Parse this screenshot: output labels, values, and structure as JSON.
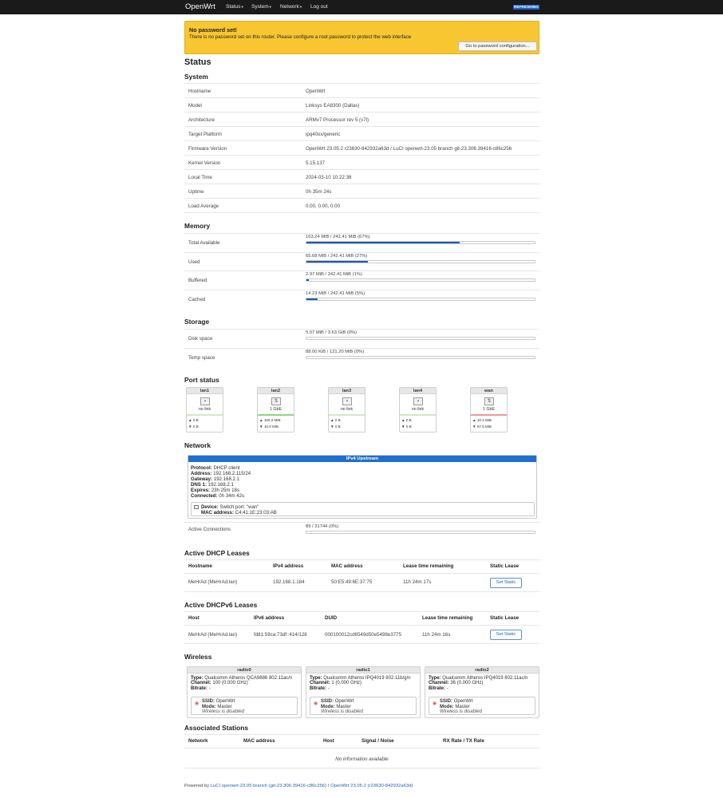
{
  "nav": {
    "brand": "OpenWrt",
    "menus": [
      {
        "label": "Status",
        "caret": "▾"
      },
      {
        "label": "System",
        "caret": "▾"
      },
      {
        "label": "Network",
        "caret": "▾"
      },
      {
        "label": "Log out",
        "caret": ""
      }
    ],
    "refreshing": "REFRESHING"
  },
  "alert": {
    "title": "No password set!",
    "message": "There is no password set on this router. Please configure a root password to protect the web interface",
    "button": "Go to password configuration..."
  },
  "page_title": "Status",
  "system": {
    "heading": "System",
    "rows": [
      {
        "k": "Hostname",
        "v": "OpenWrt"
      },
      {
        "k": "Model",
        "v": "Linksys EA8300 (Dallas)"
      },
      {
        "k": "Architecture",
        "v": "ARMv7 Processor rev 5 (v7l)"
      },
      {
        "k": "Target Platform",
        "v": "ipq40xx/generic"
      },
      {
        "k": "Firmware Version",
        "v": "OpenWrt 23.05.2 r23630-842932a63d / LuCI openwrt-23.05 branch git-23.306.39416-c86c256"
      },
      {
        "k": "Kernel Version",
        "v": "5.15.137"
      },
      {
        "k": "Local Time",
        "v": "2024-03-10 10:22:38"
      },
      {
        "k": "Uptime",
        "v": "0h 35m 24s"
      },
      {
        "k": "Load Average",
        "v": "0.00, 0.00, 0.00"
      }
    ]
  },
  "memory": {
    "heading": "Memory",
    "rows": [
      {
        "k": "Total Available",
        "v": "163.24 MiB / 242.41 MiB (67%)",
        "pct": 67
      },
      {
        "k": "Used",
        "v": "65.68 MiB / 242.41 MiB (27%)",
        "pct": 27
      },
      {
        "k": "Buffered",
        "v": "2.97 MiB / 242.41 MiB (1%)",
        "pct": 1
      },
      {
        "k": "Cached",
        "v": "14.23 MiB / 242.41 MiB (5%)",
        "pct": 5
      }
    ]
  },
  "storage": {
    "heading": "Storage",
    "rows": [
      {
        "k": "Disk space",
        "v": "5.07 MiB / 3.63 GiB (0%)",
        "pct": 0
      },
      {
        "k": "Temp space",
        "v": "88.00 KiB / 121.20 MiB (0%)",
        "pct": 0
      }
    ]
  },
  "ports": {
    "heading": "Port status",
    "items": [
      {
        "name": "lan1",
        "status": "no link",
        "rx": "▲ 0 B",
        "tx": "▼ 0 B",
        "color": "#cfe8c4",
        "up": false
      },
      {
        "name": "lan2",
        "status": "1 GbE",
        "rx": "▲ 100.2 MiB",
        "tx": "▼ 10.0 MiB",
        "color": "#8fd67a",
        "up": true
      },
      {
        "name": "lan3",
        "status": "no link",
        "rx": "▲ 0 B",
        "tx": "▼ 0 B",
        "color": "#cfe8c4",
        "up": false
      },
      {
        "name": "lan4",
        "status": "no link",
        "rx": "▲ 0 B",
        "tx": "▼ 0 B",
        "color": "#cfe8c4",
        "up": false
      },
      {
        "name": "wan",
        "status": "1 GbE",
        "rx": "▲ 10.4 MiB",
        "tx": "▼ 97.6 MiB",
        "color": "#f2959a",
        "up": true
      }
    ]
  },
  "network": {
    "heading": "Network",
    "box_title": "IPv4 Upstream",
    "info": [
      {
        "k": "Protocol:",
        "v": "DHCP client"
      },
      {
        "k": "Address:",
        "v": "192.168.2.115/24"
      },
      {
        "k": "Gateway:",
        "v": "192.168.2.1"
      },
      {
        "k": "DNS 1:",
        "v": "192.168.2.1"
      },
      {
        "k": "Expires:",
        "v": "23h 25m 18s"
      },
      {
        "k": "Connected:",
        "v": "0h 34m 42s"
      }
    ],
    "device_label": "Device:",
    "device_value": "Switch port: \"wan\"",
    "mac_label": "MAC address:",
    "mac_value": "C4:41:1E:23:03:AB",
    "conn_label": "Active Connections",
    "conn_value": "89 / 31744 (0%)",
    "conn_pct": 0
  },
  "dhcp": {
    "heading": "Active DHCP Leases",
    "headers": [
      "Hostname",
      "IPv4 address",
      "MAC address",
      "Lease time remaining",
      "Static Lease"
    ],
    "row": [
      "MeHrAd (MeHrAd.lan)",
      "192.168.1.184",
      "50:E5:49:6E:37:75",
      "11h 24m 17s"
    ],
    "button": "Set Static"
  },
  "dhcp6": {
    "heading": "Active DHCPv6 Leases",
    "headers": [
      "Host",
      "IPv6 address",
      "DUID",
      "Lease time remaining",
      "Static Lease"
    ],
    "row": [
      "MeHrAd (MeHrAd.lan)",
      "fd81:59ca:73df::414/128",
      "000100012cd6549d50e5498e3775",
      "11h 24m 16s"
    ],
    "button": "Set Static"
  },
  "wireless": {
    "heading": "Wireless",
    "radios": [
      {
        "name": "radio0",
        "type_k": "Type:",
        "type_v": "Qualcomm Atheros QCA9886 802.11ac/n",
        "ch_k": "Channel:",
        "ch_v": "100 (0.000 GHz)",
        "br_k": "Bitrate:",
        "br_v": "-",
        "ssid_k": "SSID:",
        "ssid_v": "OpenWrt",
        "mode_k": "Mode:",
        "mode_v": "Master",
        "state": "Wireless is disabled"
      },
      {
        "name": "radio1",
        "type_k": "Type:",
        "type_v": "Qualcomm Atheros IPQ4019 802.11b/g/n",
        "ch_k": "Channel:",
        "ch_v": "1 (0.000 GHz)",
        "br_k": "Bitrate:",
        "br_v": "-",
        "ssid_k": "SSID:",
        "ssid_v": "OpenWrt",
        "mode_k": "Mode:",
        "mode_v": "Master",
        "state": "Wireless is disabled"
      },
      {
        "name": "radio2",
        "type_k": "Type:",
        "type_v": "Qualcomm Atheros IPQ4019 802.11ac/n",
        "ch_k": "Channel:",
        "ch_v": "36 (0.000 GHz)",
        "br_k": "Bitrate:",
        "br_v": "-",
        "ssid_k": "SSID:",
        "ssid_v": "OpenWrt",
        "mode_k": "Mode:",
        "mode_v": "Master",
        "state": "Wireless is disabled"
      }
    ]
  },
  "stations": {
    "heading": "Associated Stations",
    "headers": [
      "Network",
      "MAC address",
      "Host",
      "Signal / Noise",
      "RX Rate / TX Rate"
    ],
    "empty": "No information available"
  },
  "footer": {
    "powered": "Powered by ",
    "luci": "LuCI openwrt-23.05 branch (git-23.306.39416-c86c256)",
    "sep": " / ",
    "fw": "OpenWrt 23.05.2 (r23630-842932a63d)"
  }
}
